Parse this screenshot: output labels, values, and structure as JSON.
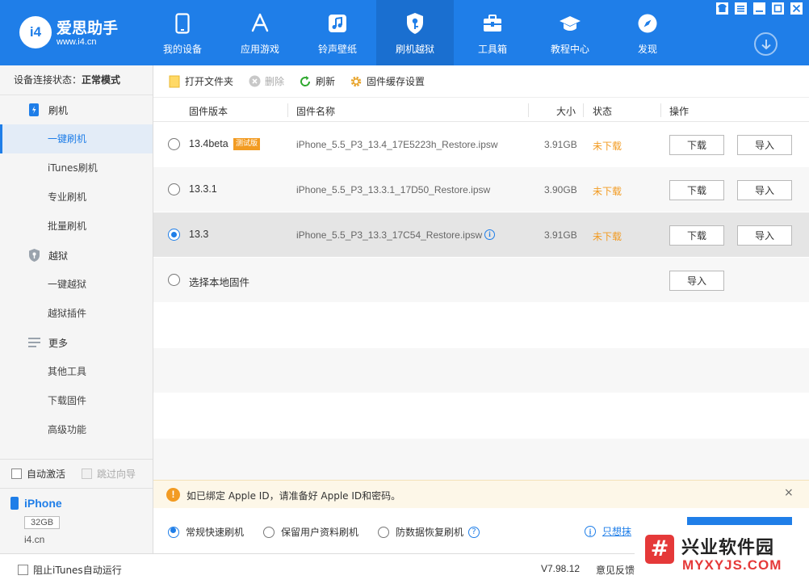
{
  "app": {
    "name": "爱思助手",
    "url": "www.i4.cn",
    "badge": "i4"
  },
  "nav": [
    {
      "label": "我的设备",
      "icon": "phone-icon"
    },
    {
      "label": "应用游戏",
      "icon": "app-store-icon"
    },
    {
      "label": "铃声壁纸",
      "icon": "music-note-icon"
    },
    {
      "label": "刷机越狱",
      "icon": "shield-key-icon",
      "active": true
    },
    {
      "label": "工具箱",
      "icon": "toolbox-icon"
    },
    {
      "label": "教程中心",
      "icon": "graduation-cap-icon"
    },
    {
      "label": "发现",
      "icon": "compass-icon"
    }
  ],
  "sidebar": {
    "status_label": "设备连接状态：",
    "status_value": "正常模式",
    "groups": [
      {
        "label": "刷机",
        "icon": "flash-phone-icon",
        "items": [
          "一键刷机",
          "iTunes刷机",
          "专业刷机",
          "批量刷机"
        ]
      },
      {
        "label": "越狱",
        "icon": "jailbreak-shield-icon",
        "items": [
          "一键越狱",
          "越狱插件"
        ]
      },
      {
        "label": "更多",
        "icon": "menu-lines-icon",
        "items": [
          "其他工具",
          "下载固件",
          "高级功能"
        ]
      }
    ],
    "active_item": "一键刷机",
    "auto_activate": "自动激活",
    "skip_guide": "跳过向导"
  },
  "device": {
    "name": "iPhone",
    "capacity": "32GB",
    "site": "i4.cn"
  },
  "toolbar": {
    "open_folder": "打开文件夹",
    "delete": "删除",
    "refresh": "刷新",
    "cache_settings": "固件缓存设置"
  },
  "table": {
    "headers": {
      "version": "固件版本",
      "name": "固件名称",
      "size": "大小",
      "status": "状态",
      "action": "操作"
    },
    "rows": [
      {
        "version": "13.4beta",
        "badge": "测试版",
        "name": "iPhone_5.5_P3_13.4_17E5223h_Restore.ipsw",
        "size": "3.91GB",
        "status": "未下载",
        "download": "下载",
        "import": "导入"
      },
      {
        "version": "13.3.1",
        "name": "iPhone_5.5_P3_13.3.1_17D50_Restore.ipsw",
        "size": "3.90GB",
        "status": "未下载",
        "download": "下载",
        "import": "导入"
      },
      {
        "version": "13.3",
        "name": "iPhone_5.5_P3_13.3_17C54_Restore.ipsw",
        "size": "3.91GB",
        "status": "未下载",
        "download": "下载",
        "import": "导入",
        "selected": true
      },
      {
        "version": "选择本地固件",
        "import": "导入"
      }
    ]
  },
  "notice": {
    "text": "如已绑定 Apple ID，请准备好 Apple ID和密码。",
    "close": "×"
  },
  "modes": {
    "fast": "常规快速刷机",
    "keep_data": "保留用户资料刷机",
    "recovery": "防数据恢复刷机",
    "erase_link": "只想抹"
  },
  "footer": {
    "block_itunes": "阻止iTunes自动运行",
    "version": "V7.98.12",
    "feedback": "意见反馈"
  },
  "watermark": {
    "cn": "兴业软件园",
    "en": "MYXYJS.COM",
    "mark": "#"
  },
  "colors": {
    "brand": "#1f7ee8",
    "warning": "#f29b22",
    "watermark_red": "#e53939"
  }
}
